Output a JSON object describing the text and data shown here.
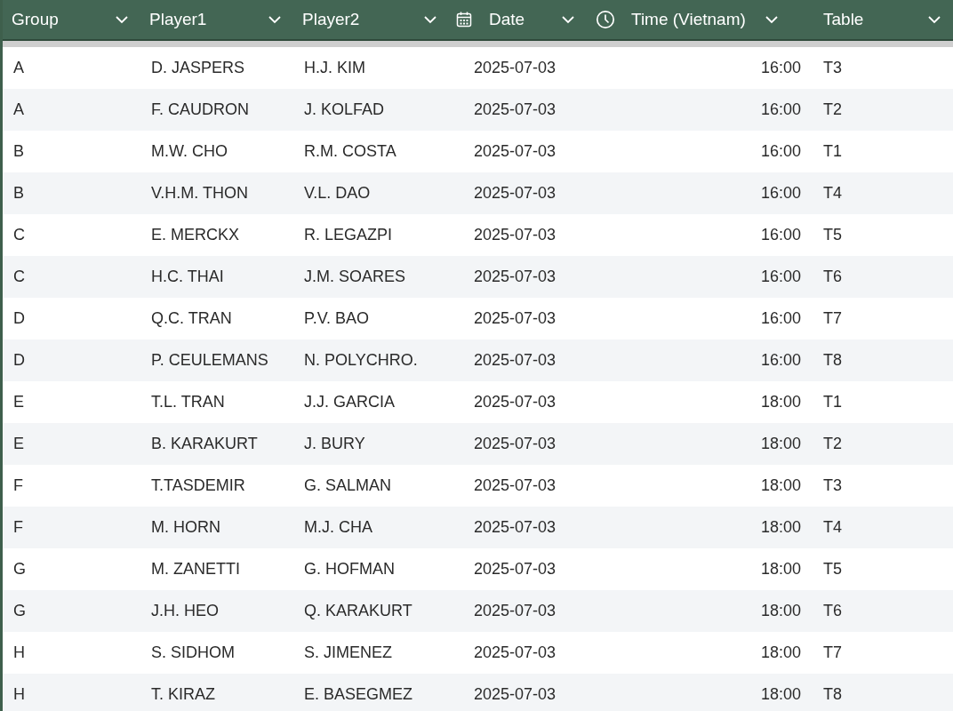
{
  "table": {
    "columns": [
      "Group",
      "Player1",
      "Player2",
      "Date",
      "Time (Vietnam)",
      "Table"
    ],
    "rows": [
      [
        "A",
        "D. JASPERS",
        "H.J. KIM",
        "2025-07-03",
        "16:00",
        "T3"
      ],
      [
        "A",
        "F. CAUDRON",
        "J. KOLFAD",
        "2025-07-03",
        "16:00",
        "T2"
      ],
      [
        "B",
        "M.W. CHO",
        "R.M. COSTA",
        "2025-07-03",
        "16:00",
        "T1"
      ],
      [
        "B",
        "V.H.M. THON",
        "V.L. DAO",
        "2025-07-03",
        "16:00",
        "T4"
      ],
      [
        "C",
        "E. MERCKX",
        "R. LEGAZPI",
        "2025-07-03",
        "16:00",
        "T5"
      ],
      [
        "C",
        "H.C. THAI",
        "J.M. SOARES",
        "2025-07-03",
        "16:00",
        "T6"
      ],
      [
        "D",
        "Q.C. TRAN",
        "P.V. BAO",
        "2025-07-03",
        "16:00",
        "T7"
      ],
      [
        "D",
        "P. CEULEMANS",
        "N. POLYCHRO.",
        "2025-07-03",
        "16:00",
        "T8"
      ],
      [
        "E",
        "T.L. TRAN",
        "J.J. GARCIA",
        "2025-07-03",
        "18:00",
        "T1"
      ],
      [
        "E",
        "B. KARAKURT",
        "J. BURY",
        "2025-07-03",
        "18:00",
        "T2"
      ],
      [
        "F",
        "T.TASDEMIR",
        "G. SALMAN",
        "2025-07-03",
        "18:00",
        "T3"
      ],
      [
        "F",
        "M. HORN",
        "M.J. CHA",
        "2025-07-03",
        "18:00",
        "T4"
      ],
      [
        "G",
        "M. ZANETTI",
        "G. HOFMAN",
        "2025-07-03",
        "18:00",
        "T5"
      ],
      [
        "G",
        "J.H. HEO",
        "Q. KARAKURT",
        "2025-07-03",
        "18:00",
        "T6"
      ],
      [
        "H",
        "S. SIDHOM",
        "S. JIMENEZ",
        "2025-07-03",
        "18:00",
        "T7"
      ],
      [
        "H",
        "T. KIRAZ",
        "E. BASEGMEZ",
        "2025-07-03",
        "18:00",
        "T8"
      ]
    ]
  }
}
